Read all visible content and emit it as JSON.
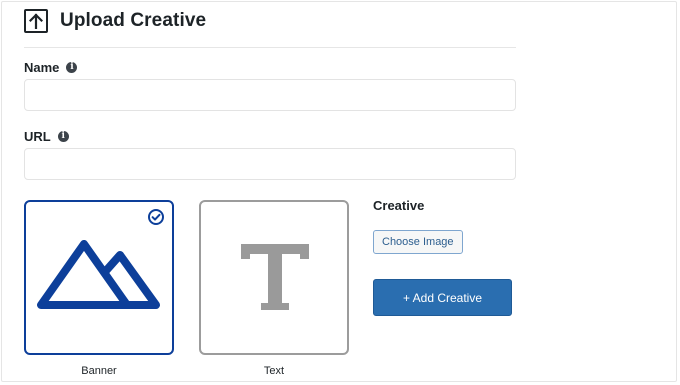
{
  "header": {
    "title": "Upload Creative",
    "icon": "upload-icon"
  },
  "fields": {
    "name_label": "Name",
    "name_value": "",
    "url_label": "URL",
    "url_value": ""
  },
  "creative_types": [
    {
      "label": "Banner",
      "icon": "mountain-icon",
      "selected": true
    },
    {
      "label": "Text",
      "icon": "letter-t-icon",
      "selected": false
    }
  ],
  "creative": {
    "label": "Creative",
    "choose_label": "Choose Image",
    "add_label": "+ Add Creative"
  },
  "colors": {
    "accent": "#0d3f9a",
    "button": "#2a6eb0",
    "unselected_border": "#9c9c9c",
    "text_icon": "#9a9a9a"
  }
}
